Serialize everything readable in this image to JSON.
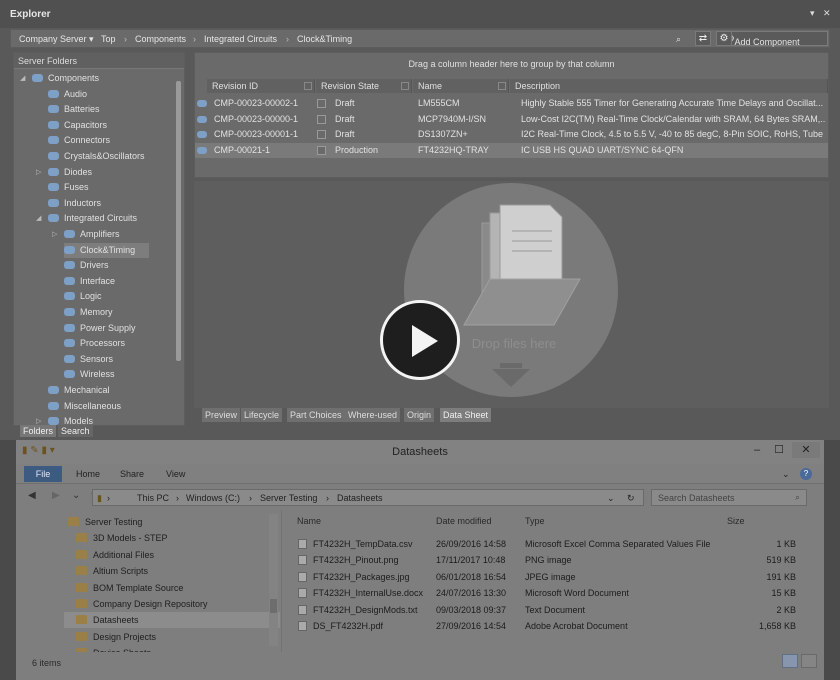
{
  "explorer": {
    "title": "Explorer",
    "pin": "▾",
    "close": "✕",
    "toolbar": {
      "server": "Company Server",
      "breadcrumb": [
        "Top",
        "Components",
        "Integrated Circuits",
        "Clock&Timing"
      ],
      "add_label": "Add Component"
    },
    "folders": {
      "header": "Server Folders",
      "items": [
        {
          "label": "Components",
          "indent": 0,
          "arrow": "◢"
        },
        {
          "label": "Audio",
          "indent": 1
        },
        {
          "label": "Batteries",
          "indent": 1
        },
        {
          "label": "Capacitors",
          "indent": 1
        },
        {
          "label": "Connectors",
          "indent": 1
        },
        {
          "label": "Crystals&Oscillators",
          "indent": 1
        },
        {
          "label": "Diodes",
          "indent": 1,
          "arrow": "▷"
        },
        {
          "label": "Fuses",
          "indent": 1
        },
        {
          "label": "Inductors",
          "indent": 1
        },
        {
          "label": "Integrated Circuits",
          "indent": 1,
          "arrow": "◢"
        },
        {
          "label": "Amplifiers",
          "indent": 2,
          "arrow": "▷"
        },
        {
          "label": "Clock&Timing",
          "indent": 2,
          "selected": true
        },
        {
          "label": "Drivers",
          "indent": 2
        },
        {
          "label": "Interface",
          "indent": 2
        },
        {
          "label": "Logic",
          "indent": 2
        },
        {
          "label": "Memory",
          "indent": 2
        },
        {
          "label": "Power Supply",
          "indent": 2
        },
        {
          "label": "Processors",
          "indent": 2
        },
        {
          "label": "Sensors",
          "indent": 2
        },
        {
          "label": "Wireless",
          "indent": 2
        },
        {
          "label": "Mechanical",
          "indent": 1
        },
        {
          "label": "Miscellaneous",
          "indent": 1
        },
        {
          "label": "Models",
          "indent": 1,
          "arrow": "▷"
        }
      ]
    },
    "bottom_tabs": [
      "Folders",
      "Search"
    ],
    "grid": {
      "group_hint": "Drag a column header here to group by that column",
      "columns": [
        "Revision ID",
        "Revision State",
        "Name",
        "Description"
      ],
      "rows": [
        {
          "id": "CMP-00023-00002-1",
          "state": "Draft",
          "name": "LM555CM",
          "desc": "Highly Stable 555 Timer for Generating Accurate Time Delays and Oscillat..."
        },
        {
          "id": "CMP-00023-00000-1",
          "state": "Draft",
          "name": "MCP7940M-I/SN",
          "desc": "Low-Cost I2C(TM) Real-Time Clock/Calendar with SRAM, 64 Bytes SRAM,..."
        },
        {
          "id": "CMP-00023-00001-1",
          "state": "Draft",
          "name": "DS1307ZN+",
          "desc": "I2C Real-Time Clock, 4.5 to 5.5 V, -40 to 85 degC, 8-Pin SOIC, RoHS, Tube"
        },
        {
          "id": "CMP-00021-1",
          "state": "Production",
          "name": "FT4232HQ-TRAY",
          "desc": "IC USB HS QUAD UART/SYNC 64-QFN",
          "selected": true
        }
      ]
    },
    "preview": {
      "drop_text": "Drop files here",
      "tabs": [
        "Preview",
        "Lifecycle",
        "Part Choices",
        "Where-used",
        "Origin",
        "Data Sheet"
      ],
      "active_tab": "Data Sheet"
    }
  },
  "windows_explorer": {
    "title": "Datasheets",
    "ribbon": [
      "File",
      "Home",
      "Share",
      "View"
    ],
    "address": [
      "This PC",
      "Windows (C:)",
      "Server Testing",
      "Datasheets"
    ],
    "search_placeholder": "Search Datasheets",
    "nav_items": [
      {
        "label": "Server Testing",
        "indent": 0
      },
      {
        "label": "3D Models - STEP",
        "indent": 1
      },
      {
        "label": "Additional Files",
        "indent": 1
      },
      {
        "label": "Altium Scripts",
        "indent": 1
      },
      {
        "label": "BOM Template Source",
        "indent": 1
      },
      {
        "label": "Company Design Repository",
        "indent": 1
      },
      {
        "label": "Datasheets",
        "indent": 1,
        "selected": true
      },
      {
        "label": "Design Projects",
        "indent": 1
      },
      {
        "label": "Device Sheets",
        "indent": 1
      }
    ],
    "columns": [
      "Name",
      "Date modified",
      "Type",
      "Size"
    ],
    "files": [
      {
        "name": "FT4232H_TempData.csv",
        "date": "26/09/2016 14:58",
        "type": "Microsoft Excel Comma Separated Values File",
        "size": "1 KB"
      },
      {
        "name": "FT4232H_Pinout.png",
        "date": "17/11/2017 10:48",
        "type": "PNG image",
        "size": "519 KB"
      },
      {
        "name": "FT4232H_Packages.jpg",
        "date": "06/01/2018 16:54",
        "type": "JPEG image",
        "size": "191 KB"
      },
      {
        "name": "FT4232H_InternalUse.docx",
        "date": "24/07/2016 13:30",
        "type": "Microsoft Word Document",
        "size": "15 KB"
      },
      {
        "name": "FT4232H_DesignMods.txt",
        "date": "09/03/2018 09:37",
        "type": "Text Document",
        "size": "2 KB"
      },
      {
        "name": "DS_FT4232H.pdf",
        "date": "27/09/2016 14:54",
        "type": "Adobe Acrobat Document",
        "size": "1,658 KB"
      }
    ],
    "status": "6 items"
  }
}
